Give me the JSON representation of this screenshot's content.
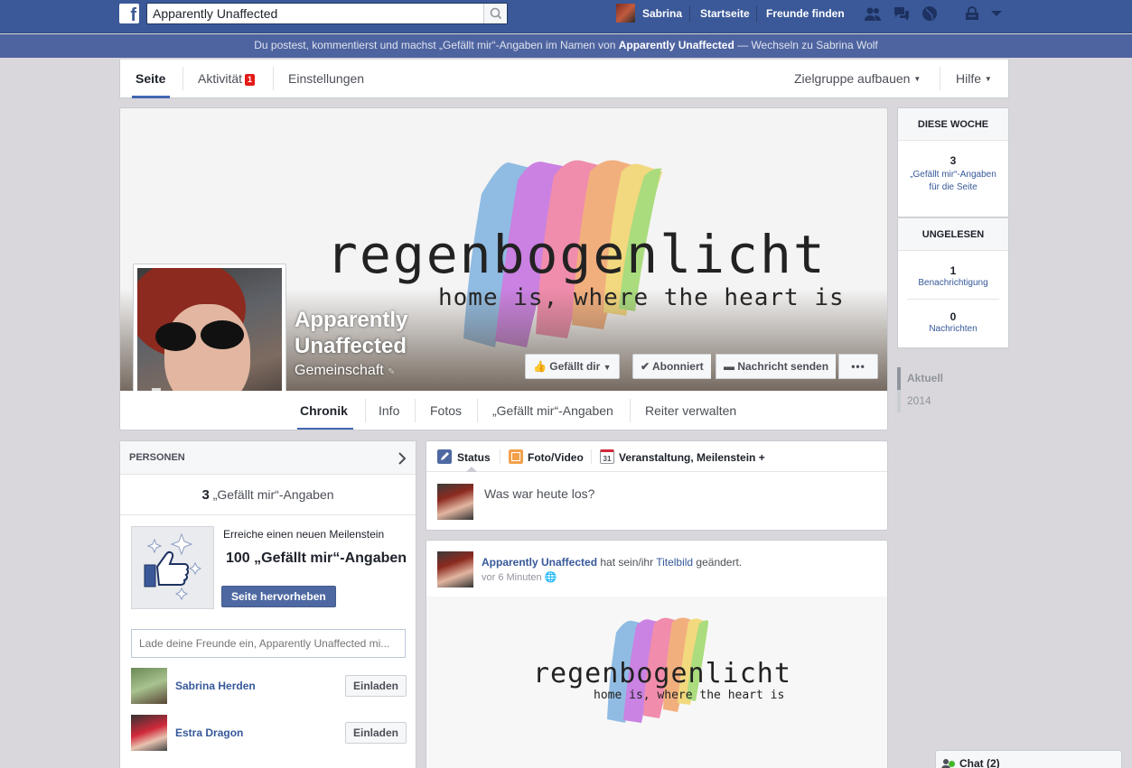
{
  "topbar": {
    "search_value": "Apparently Unaffected",
    "user_name": "Sabrina",
    "home_label": "Startseite",
    "find_friends_label": "Freunde finden"
  },
  "acting_banner": {
    "prefix": "Du postest, kommentierst und machst „Gefällt mir“-Angaben im Namen von ",
    "page_name": "Apparently Unaffected",
    "suffix": " — Wechseln zu Sabrina Wolf"
  },
  "admin_nav": {
    "tabs": [
      {
        "label": "Seite"
      },
      {
        "label": "Aktivität",
        "badge": "1"
      },
      {
        "label": "Einstellungen"
      }
    ],
    "audience_label": "Zielgruppe aufbauen",
    "help_label": "Hilfe"
  },
  "cover": {
    "brand_word": "regenbogenlicht",
    "tagline": "home is, where the heart is",
    "page_name_line1": "Apparently",
    "page_name_line2": "Unaffected",
    "category": "Gemeinschaft",
    "like_button": "Gefällt dir",
    "subscribed_button": "Abonniert",
    "message_button": "Nachricht senden",
    "more_button": "•••"
  },
  "chronicle_nav": {
    "tabs": [
      "Chronik",
      "Info",
      "Fotos",
      "„Gefällt mir“-Angaben",
      "Reiter verwalten"
    ]
  },
  "right_column": {
    "this_week_title": "DIESE WOCHE",
    "this_week_count": "3",
    "this_week_label": "„Gefällt mir“-Angaben für die Seite",
    "unread_title": "UNGELESEN",
    "notifications_count": "1",
    "notifications_label": "Benachrichtigung",
    "messages_count": "0",
    "messages_label": "Nachrichten",
    "timeline": [
      "Aktuell",
      "2014"
    ]
  },
  "people": {
    "title": "PERSONEN",
    "likes_count": "3",
    "likes_label": " „Gefällt mir“-Angaben",
    "milestone_title": "Erreiche einen neuen Meilenstein",
    "milestone_value": "100 „Gefällt mir“-Angaben",
    "promote_button": "Seite hervorheben",
    "invite_placeholder": "Lade deine Freunde ein, Apparently Unaffected mi...",
    "friends": [
      {
        "name": "Sabrina Herden",
        "button": "Einladen"
      },
      {
        "name": "Estra Dragon",
        "button": "Einladen"
      }
    ]
  },
  "composer": {
    "tab_status": "Status",
    "tab_photo": "Foto/Video",
    "tab_event": "Veranstaltung, Meilenstein +",
    "event_icon_text": "31",
    "prompt": "Was war heute los?"
  },
  "story": {
    "author": "Apparently Unaffected",
    "action_pre": " hat sein/ihr ",
    "action_link": "Titelbild",
    "action_post": " geändert.",
    "time": "vor 6 Minuten"
  },
  "chat": {
    "label": "Chat (2)"
  },
  "colors": {
    "brand_blue": "#3b5998",
    "link_blue": "#365899",
    "badge_red": "#e41b17"
  }
}
